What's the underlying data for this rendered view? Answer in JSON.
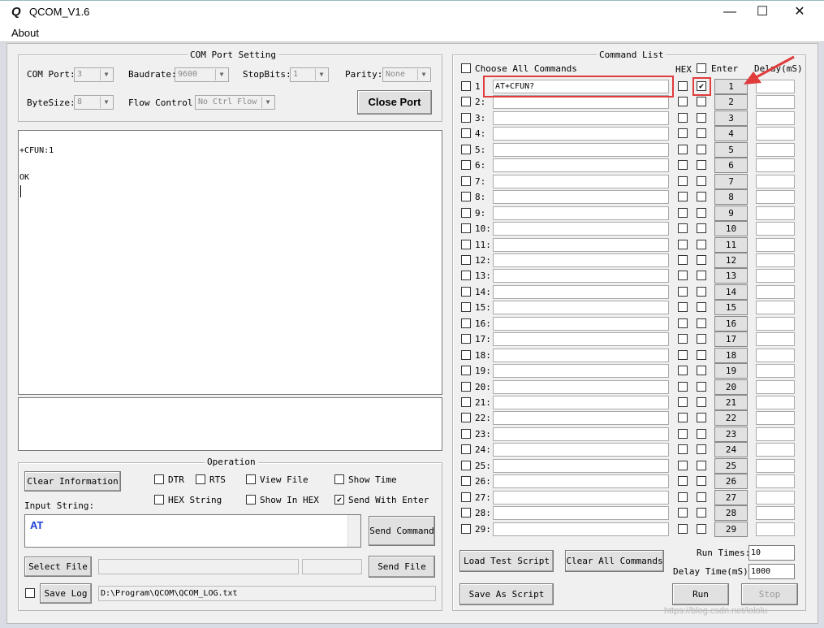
{
  "window": {
    "title": "QCOM_V1.6",
    "icon_letter": "Q",
    "min_glyph": "—",
    "max_glyph": "☐",
    "close_glyph": "✕"
  },
  "menu": {
    "about": "About"
  },
  "com_port_setting": {
    "title": "COM Port Setting",
    "com_port_label": "COM Port:",
    "com_port_value": "3",
    "baudrate_label": "Baudrate:",
    "baudrate_value": "9600",
    "stopbits_label": "StopBits:",
    "stopbits_value": "1",
    "parity_label": "Parity:",
    "parity_value": "None",
    "bytesize_label": "ByteSize:",
    "bytesize_value": "8",
    "flow_label": "Flow Control:",
    "flow_value": "No Ctrl Flow",
    "close_port": "Close Port"
  },
  "receive": {
    "lines": [
      "+CFUN:1",
      "",
      "OK"
    ]
  },
  "operation": {
    "title": "Operation",
    "clear_info": "Clear Information",
    "dtr": "DTR",
    "rts": "RTS",
    "view_file": "View File",
    "show_time": "Show Time",
    "hex_string": "HEX String",
    "show_in_hex": "Show In HEX",
    "send_with_enter": "Send With Enter",
    "input_label": "Input String:",
    "input_value": "AT",
    "send_command": "Send Command",
    "select_file": "Select File",
    "send_file": "Send File",
    "save_log": "Save Log",
    "log_path": "D:\\Program\\QCOM\\QCOM_LOG.txt"
  },
  "command_list": {
    "title": "Command List",
    "choose_all": "Choose All Commands",
    "hex_header": "HEX",
    "enter_header": "Enter",
    "delay_header": "Delay(mS)",
    "rows": [
      {
        "num": "1",
        "label": "1",
        "cmd": "AT+CFUN?",
        "enter": true
      },
      {
        "num": "2",
        "label": "2:",
        "cmd": "",
        "enter": false
      },
      {
        "num": "3",
        "label": "3:",
        "cmd": "",
        "enter": false
      },
      {
        "num": "4",
        "label": "4:",
        "cmd": "",
        "enter": false
      },
      {
        "num": "5",
        "label": "5:",
        "cmd": "",
        "enter": false
      },
      {
        "num": "6",
        "label": "6:",
        "cmd": "",
        "enter": false
      },
      {
        "num": "7",
        "label": "7:",
        "cmd": "",
        "enter": false
      },
      {
        "num": "8",
        "label": "8:",
        "cmd": "",
        "enter": false
      },
      {
        "num": "9",
        "label": "9:",
        "cmd": "",
        "enter": false
      },
      {
        "num": "10",
        "label": "10:",
        "cmd": "",
        "enter": false
      },
      {
        "num": "11",
        "label": "11:",
        "cmd": "",
        "enter": false
      },
      {
        "num": "12",
        "label": "12:",
        "cmd": "",
        "enter": false
      },
      {
        "num": "13",
        "label": "13:",
        "cmd": "",
        "enter": false
      },
      {
        "num": "14",
        "label": "14:",
        "cmd": "",
        "enter": false
      },
      {
        "num": "15",
        "label": "15:",
        "cmd": "",
        "enter": false
      },
      {
        "num": "16",
        "label": "16:",
        "cmd": "",
        "enter": false
      },
      {
        "num": "17",
        "label": "17:",
        "cmd": "",
        "enter": false
      },
      {
        "num": "18",
        "label": "18:",
        "cmd": "",
        "enter": false
      },
      {
        "num": "19",
        "label": "19:",
        "cmd": "",
        "enter": false
      },
      {
        "num": "20",
        "label": "20:",
        "cmd": "",
        "enter": false
      },
      {
        "num": "21",
        "label": "21:",
        "cmd": "",
        "enter": false
      },
      {
        "num": "22",
        "label": "22:",
        "cmd": "",
        "enter": false
      },
      {
        "num": "23",
        "label": "23:",
        "cmd": "",
        "enter": false
      },
      {
        "num": "24",
        "label": "24:",
        "cmd": "",
        "enter": false
      },
      {
        "num": "25",
        "label": "25:",
        "cmd": "",
        "enter": false
      },
      {
        "num": "26",
        "label": "26:",
        "cmd": "",
        "enter": false
      },
      {
        "num": "27",
        "label": "27:",
        "cmd": "",
        "enter": false
      },
      {
        "num": "28",
        "label": "28:",
        "cmd": "",
        "enter": false
      },
      {
        "num": "29",
        "label": "29:",
        "cmd": "",
        "enter": false
      }
    ],
    "load_script": "Load Test Script",
    "clear_all": "Clear All Commands",
    "run_times_label": "Run Times:",
    "run_times_value": "10",
    "delay_time_label": "Delay Time(mS):",
    "delay_time_value": "1000",
    "save_script": "Save As Script",
    "run": "Run",
    "stop": "Stop"
  },
  "check_glyph": "✔",
  "watermark": "https://blog.csdn.net/lololu"
}
